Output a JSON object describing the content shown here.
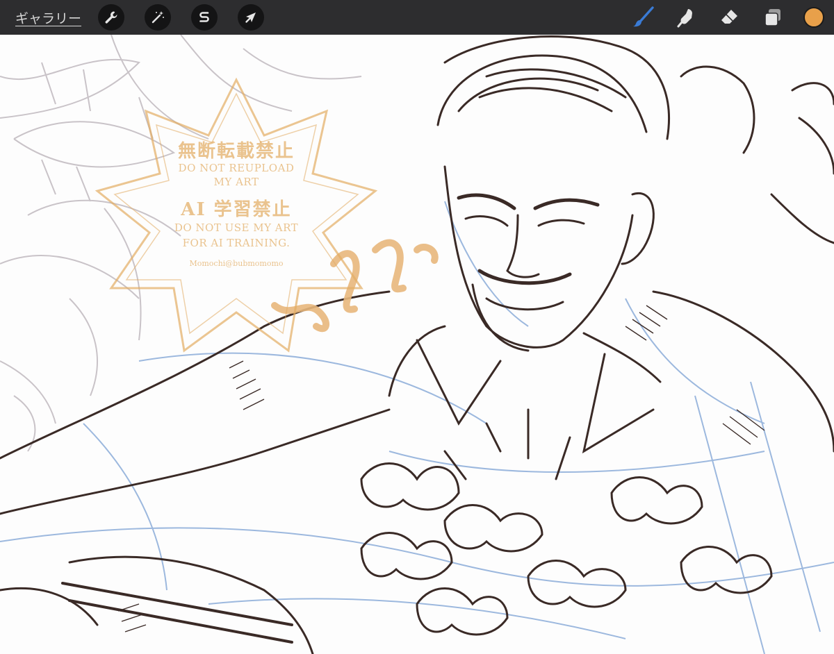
{
  "toolbar": {
    "gallery_label": "ギャラリー",
    "left_tools": [
      {
        "name": "wrench-icon",
        "label": "Actions"
      },
      {
        "name": "magic-wand-icon",
        "label": "Adjustments"
      },
      {
        "name": "selection-s-icon",
        "label": "Selection"
      },
      {
        "name": "arrow-cursor-icon",
        "label": "Transform"
      }
    ],
    "right_tools": [
      {
        "name": "brush-icon",
        "active": true
      },
      {
        "name": "smudge-icon",
        "active": false
      },
      {
        "name": "eraser-icon",
        "active": false
      },
      {
        "name": "layers-icon",
        "active": false
      }
    ],
    "current_color": "#e8a04a",
    "active_tool_color": "#3a7bd5"
  },
  "watermark": {
    "line1": "無断転載禁止",
    "line2": "DO NOT REUPLOAD",
    "line3": "MY ART",
    "line4": "AI 学習禁止",
    "line5": "DO NOT USE MY ART",
    "line6": "FOR AI TRAINING.",
    "line7": "Momochi@bubmomomo"
  },
  "colors": {
    "toolbar_bg": "#2d2d2f",
    "ink": "#3a2a26",
    "sketch": "#9cb8de",
    "background_leaves": "#c9c3c8",
    "watermark": "#e2ac62"
  }
}
